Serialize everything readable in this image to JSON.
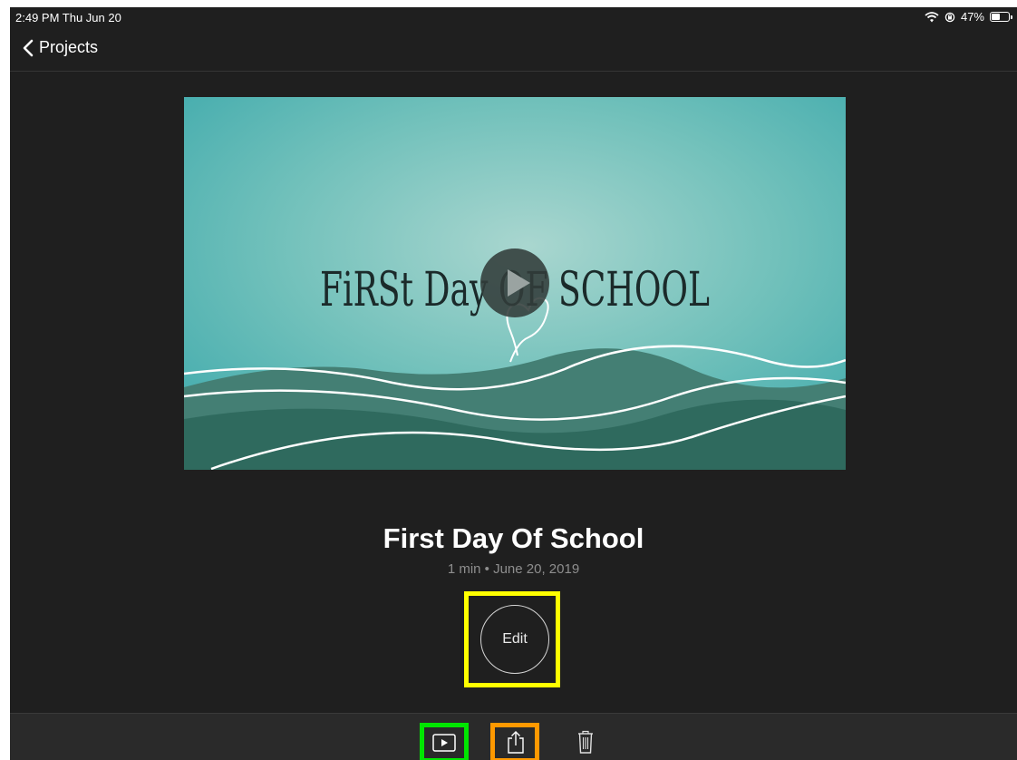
{
  "status_bar": {
    "time_date": "2:49 PM  Thu Jun 20",
    "wifi_icon": "wifi-icon",
    "rotation_lock_icon": "rotation-lock-icon",
    "battery_text": "47%",
    "battery_level": 0.47
  },
  "nav": {
    "back_label": "Projects",
    "back_icon": "chevron-left-icon"
  },
  "thumbnail": {
    "title_art_text": "FiRSt Day OF SCHOOL",
    "play_icon": "play-icon"
  },
  "project": {
    "title": "First Day Of School",
    "meta": "1 min • June 20, 2019"
  },
  "edit": {
    "label": "Edit"
  },
  "toolbar": {
    "play_icon": "play-project-icon",
    "share_icon": "share-icon",
    "trash_icon": "trash-icon"
  },
  "colors": {
    "background": "#1f1f1f",
    "toolbar": "#2a2a2a",
    "edit_highlight": "#ffff00",
    "play_highlight": "#00e600",
    "share_highlight": "#ff9900",
    "thumbnail_teal": "#5fb8b3"
  }
}
